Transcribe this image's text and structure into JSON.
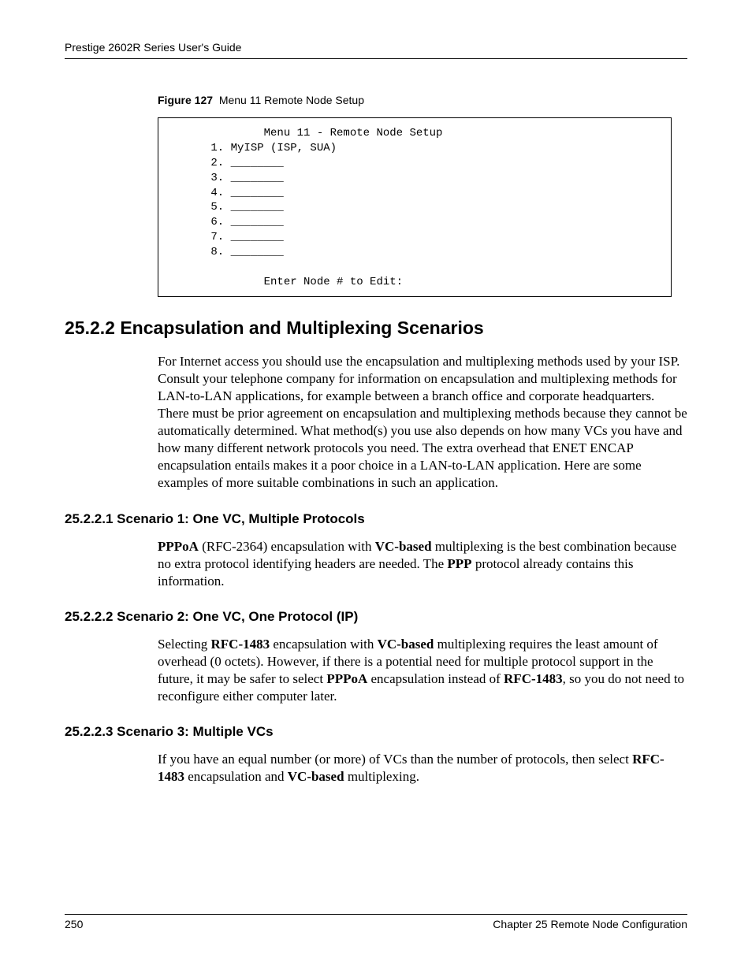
{
  "header": {
    "running_title": "Prestige 2602R Series User's Guide"
  },
  "figure": {
    "label": "Figure 127",
    "title": "Menu 11 Remote Node Setup",
    "screen": "              Menu 11 - Remote Node Setup\n      1. MyISP (ISP, SUA)\n      2. ________\n      3. ________\n      4. ________\n      5. ________\n      6. ________\n      7. ________\n      8. ________\n\n              Enter Node # to Edit:"
  },
  "section": {
    "h2": "25.2.2  Encapsulation and Multiplexing Scenarios",
    "intro": "For Internet access you should use the encapsulation and multiplexing methods used by your ISP. Consult your telephone company for information on encapsulation and multiplexing methods for LAN-to-LAN applications, for example between a branch office and corporate headquarters. There must be prior agreement on encapsulation and multiplexing methods because they cannot be automatically determined. What method(s) you use also depends on how many VCs you have and how many different network protocols you need. The extra overhead that ENET ENCAP encapsulation entails makes it a poor choice in a LAN-to-LAN application. Here are some examples of more suitable combinations in such an application.",
    "s1": {
      "h3": "25.2.2.1  Scenario 1: One VC, Multiple Protocols",
      "frag": {
        "b1": "PPPoA",
        "t1": " (RFC-2364) encapsulation with ",
        "b2": "VC-based",
        "t2": " multiplexing is the best combination because no extra protocol identifying headers are needed. The ",
        "b3": "PPP",
        "t3": " protocol already contains this information."
      }
    },
    "s2": {
      "h3": "25.2.2.2  Scenario 2: One VC, One Protocol (IP)",
      "frag": {
        "t0": "Selecting ",
        "b1": "RFC-1483",
        "t1": " encapsulation with ",
        "b2": "VC-based",
        "t2": " multiplexing requires the least amount of overhead (0 octets). However, if there is a potential need for multiple protocol support in the future, it may be safer to select ",
        "b3": "PPPoA",
        "t3": " encapsulation instead of ",
        "b4": "RFC-1483",
        "t4": ", so you do not need to reconfigure either computer later."
      }
    },
    "s3": {
      "h3": "25.2.2.3  Scenario 3: Multiple VCs",
      "frag": {
        "t0": "If you have an equal number (or more) of VCs than the number of protocols, then select ",
        "b1": "RFC-1483",
        "t1": " encapsulation and ",
        "b2": "VC-based",
        "t2": " multiplexing."
      }
    }
  },
  "footer": {
    "page_number": "250",
    "chapter": "Chapter 25 Remote Node Configuration"
  }
}
